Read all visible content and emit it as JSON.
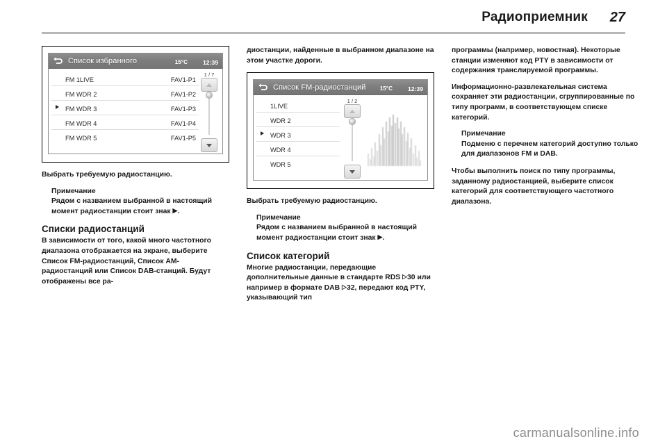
{
  "header": {
    "title": "Радиоприемник",
    "page_number": "27"
  },
  "figures": [
    {
      "name": "favourites-list-screen",
      "bar": {
        "back_icon": "back-arrow-icon",
        "title": "Список избранного",
        "temperature": "15°C",
        "clock": "12:39"
      },
      "page_indicator": "1 / 7",
      "rows": [
        {
          "marker": "",
          "name": "FM 1LIVE",
          "preset": "FAV1-P1"
        },
        {
          "marker": "",
          "name": "FM WDR 2",
          "preset": "FAV1-P2"
        },
        {
          "marker": "play",
          "name": "FM WDR 3",
          "preset": "FAV1-P3"
        },
        {
          "marker": "",
          "name": "FM WDR 4",
          "preset": "FAV1-P4"
        },
        {
          "marker": "",
          "name": "FM WDR 5",
          "preset": "FAV1-P5"
        }
      ]
    },
    {
      "name": "fm-station-list-screen",
      "bar": {
        "back_icon": "back-arrow-icon",
        "title": "Список FM-радиостанций",
        "temperature": "15°C",
        "clock": "12:39"
      },
      "page_indicator": "1 / 2",
      "rows": [
        {
          "marker": "",
          "name": "1LIVE",
          "preset": ""
        },
        {
          "marker": "",
          "name": "WDR 2",
          "preset": ""
        },
        {
          "marker": "play",
          "name": "WDR 3",
          "preset": ""
        },
        {
          "marker": "",
          "name": "WDR 4",
          "preset": ""
        },
        {
          "marker": "",
          "name": "WDR 5",
          "preset": ""
        }
      ]
    }
  ],
  "columns": {
    "left": {
      "para_after_figure": "Выбрать требуемую радиостанцию.",
      "note_title": "Примечание",
      "note_body_pre": "Рядом с названием выбранной в настоящий момент радиостанции стоит знак ",
      "note_body_post": ".",
      "section_heading": "Списки радиостанций",
      "section_para": "В зависимости от того, какой много частотного диапазона отображается на экране, выберите Список FM-радиостанций, Список AM-радиостанций или Список DAB-станций. Будут отображены все ра-"
    },
    "middle": {
      "para_top": "диостанции, найденные в выбранном диапазоне на этом участке дороги.",
      "para_after_figure": "Выбрать требуемую радиостанцию.",
      "note_title": "Примечание",
      "note_body_pre": "Рядом с названием выбранной в настоящий момент радиостанции стоит знак ",
      "note_body_post": ".",
      "section_heading": "Список категорий",
      "section_para_a": "Многие радиостанции, передающие дополнительные данные в стандарте RDS ",
      "section_ref_a": "30",
      "section_para_b": " или например в формате DAB ",
      "section_ref_b": "32",
      "section_para_c": ", передают код PTY, указывающий тип"
    },
    "right": {
      "para_top": "программы (например, новостная). Некоторые станции изменяют код PTY в зависимости от содержания транслируемой программы.",
      "para_second": "Информационно-развлекательная система сохраняет эти радиостанции, сгруппированные по типу программ, в соответствующем списке категорий.",
      "note_title": "Примечание",
      "note_body": "Подменю с перечнем категорий доступно только для диапазонов FM и DAB.",
      "para_last": "Чтобы выполнить поиск по типу программы, заданному радиостанцией, выберите список категорий для соответствующего частотного диапазона."
    }
  },
  "footer": {
    "watermark": "carmanualsonline.info"
  },
  "colors": {
    "ink": "#1a1a1a",
    "screen_bar": "#7e7e7e",
    "watermark": "#8c8c8c",
    "rule": "#000000"
  }
}
